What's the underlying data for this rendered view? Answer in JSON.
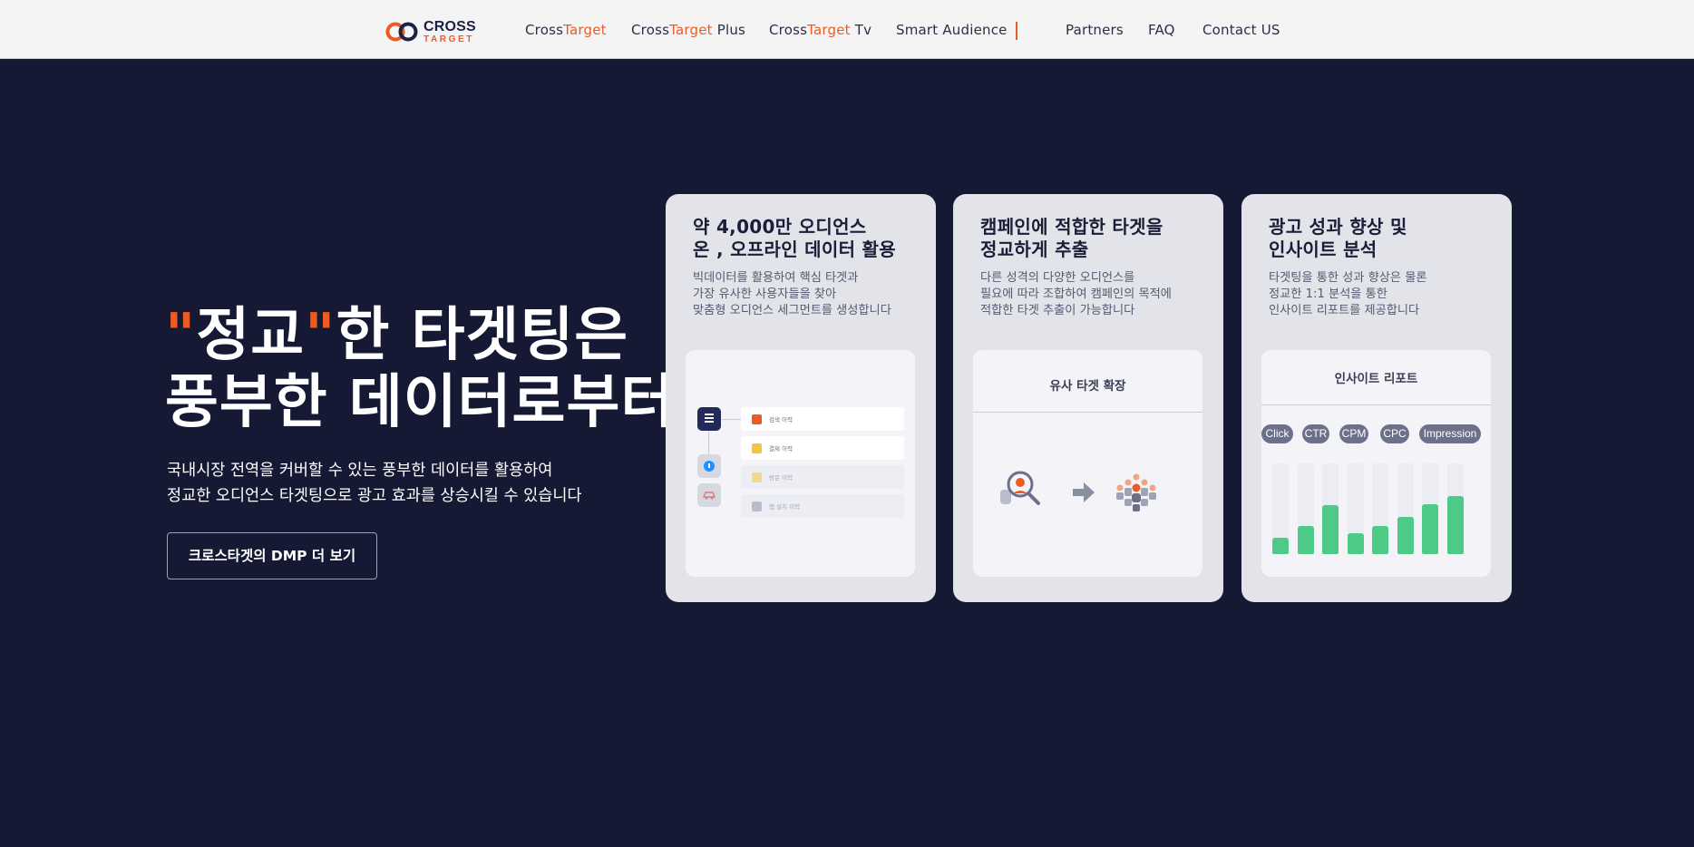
{
  "brand": {
    "line1": "CROSS",
    "line2": "TARGET",
    "accent": "#ec5b24",
    "navy": "#151933"
  },
  "nav": [
    {
      "prefix": "Cross",
      "accent": "Target",
      "suffix": ""
    },
    {
      "prefix": "Cross",
      "accent": "Target",
      "suffix": " Plus"
    },
    {
      "prefix": "Cross",
      "accent": "Target",
      "suffix": " Tv"
    },
    {
      "prefix": "Smart Audience",
      "accent": "",
      "suffix": ""
    },
    {
      "prefix": "Partners",
      "accent": "",
      "suffix": ""
    },
    {
      "prefix": "FAQ",
      "accent": "",
      "suffix": ""
    },
    {
      "prefix": "Contact US",
      "accent": "",
      "suffix": ""
    }
  ],
  "hero": {
    "quote_open": "\"",
    "highlight": "정교",
    "quote_close": "\"",
    "line1_rest": "한 타겟팅은",
    "line2": "풍부한 데이터로부터",
    "sub1": "국내시장 전역을 커버할 수 있는 풍부한 데이터를 활용하여",
    "sub2": "정교한 오디언스 타겟팅으로 광고 효과를 상승시킬 수 있습니다",
    "cta": "크로스타겟의 DMP 더 보기"
  },
  "cards": [
    {
      "title1": "약 4,000만 오디언스",
      "title2": "온 , 오프라인 데이터 활용",
      "desc1": "빅데이터를 활용하여 핵심 타겟과",
      "desc2": "가장 유사한 사용자들을 찾아",
      "desc3": "맞춤형 오디언스 세그먼트를 생성합니다",
      "rows": [
        "검색 이력",
        "결제 이력",
        "방문 이력",
        "앱 설치 이력"
      ]
    },
    {
      "title1": "캠페인에 적합한 타겟을",
      "title2": "정교하게 추출",
      "desc1": "다른 성격의 다양한 오디언스를",
      "desc2": "필요에 따라 조합하여 캠페인의 목적에",
      "desc3": "적합한 타겟 추출이 가능합니다",
      "panel_title": "유사 타겟 확장"
    },
    {
      "title1": "광고 성과 향상 및",
      "title2": "인사이트 분석",
      "desc1": "타겟팅을 통한 성과 향상은 물론",
      "desc2": "정교한 1:1 분석을 통한",
      "desc3": "인사이트 리포트를 제공합니다",
      "panel_title": "인사이트 리포트",
      "tags": [
        "Click",
        "CTR",
        "CPM",
        "CPC",
        "Impression"
      ],
      "bars": [
        0.22,
        0.38,
        0.66,
        0.28,
        0.38,
        0.5,
        0.67,
        0.78
      ]
    }
  ]
}
